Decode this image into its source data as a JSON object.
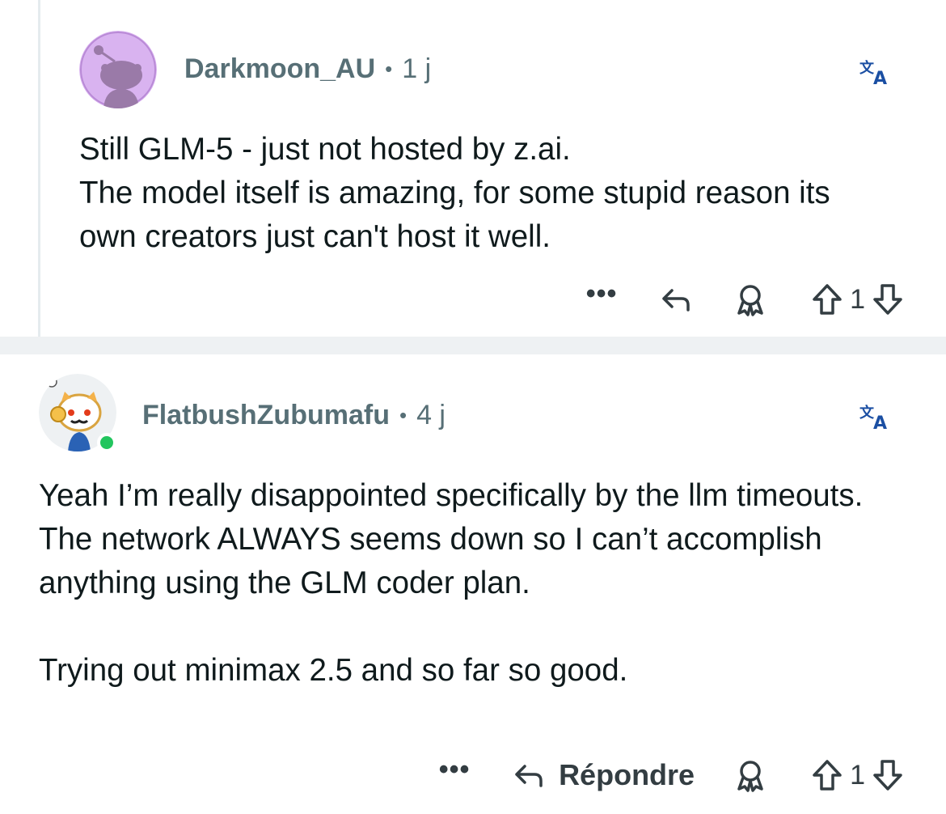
{
  "comments": [
    {
      "username": "Darkmoon_AU",
      "separator": "•",
      "age": "1 j",
      "text": "Still GLM-5 - just not hosted by z.ai.\nThe model itself is amazing, for some stupid reason its own creators just can't host it well.",
      "more": "•••",
      "reply_label": "",
      "score": "1",
      "avatar_color": "#d9b3f0"
    },
    {
      "username": "FlatbushZubumafu",
      "separator": "•",
      "age": "4 j",
      "text": "Yeah I’m really disappointed specifically by the llm timeouts. The network ALWAYS seems down so I can’t accomplish anything using the GLM coder plan.\n\nTrying out minimax 2.5 and so far so good.",
      "more": "•••",
      "reply_label": "Répondre",
      "score": "1",
      "online": true
    }
  ],
  "colors": {
    "meta": "#576f76",
    "translate": "#1b4fa3",
    "online": "#22c55e",
    "separator": "#eef1f3"
  },
  "icons": [
    "translate-icon",
    "more-icon",
    "reply-icon",
    "award-icon",
    "upvote-icon",
    "downvote-icon"
  ]
}
